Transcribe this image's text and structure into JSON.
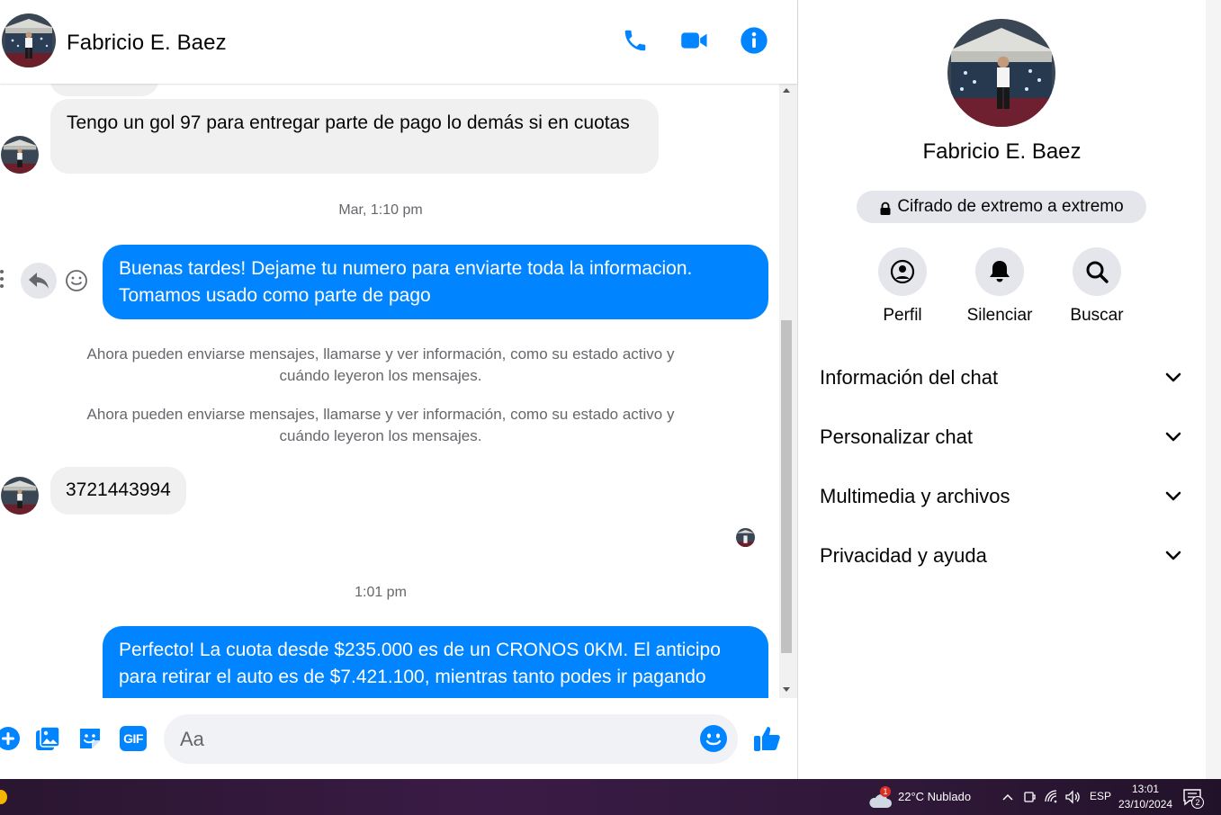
{
  "header": {
    "contact_name": "Fabricio E. Baez"
  },
  "messages": {
    "msg1": "Tengo  un gol 97  para entregar parte de pago lo demás si en cuotas",
    "timestamp1": "Mar, 1:10 pm",
    "msg2": "Buenas tardes! Dejame tu numero para enviarte toda la informacion. Tomamos usado como parte de pago",
    "system1": "Ahora pueden enviarse mensajes, llamarse y ver información, como su estado activo y cuándo leyeron los mensajes.",
    "system2": "Ahora pueden enviarse mensajes, llamarse y ver información, como su estado activo y cuándo leyeron los mensajes.",
    "msg3": "3721443994",
    "timestamp2": "1:01 pm",
    "msg4": "Perfecto! La cuota desde $235.000 es de un CRONOS 0KM. El anticipo para retirar el auto es de $7.421.100, mientras tanto podes ir pagando"
  },
  "composer": {
    "placeholder": "Aa",
    "gif_label": "GIF"
  },
  "info_panel": {
    "name": "Fabricio E. Baez",
    "encryption": "Cifrado de extremo a extremo",
    "actions": [
      "Perfil",
      "Silenciar",
      "Buscar"
    ],
    "sections": [
      "Información del chat",
      "Personalizar chat",
      "Multimedia y archivos",
      "Privacidad y ayuda"
    ]
  },
  "taskbar": {
    "weather_badge": "1",
    "weather": "22°C  Nublado",
    "language": "ESP",
    "time": "13:01",
    "date": "23/10/2024",
    "notifications": "2"
  },
  "colors": {
    "accent": "#0084ff",
    "bubble_in": "#f0f0f0",
    "muted_text": "#65676b"
  }
}
